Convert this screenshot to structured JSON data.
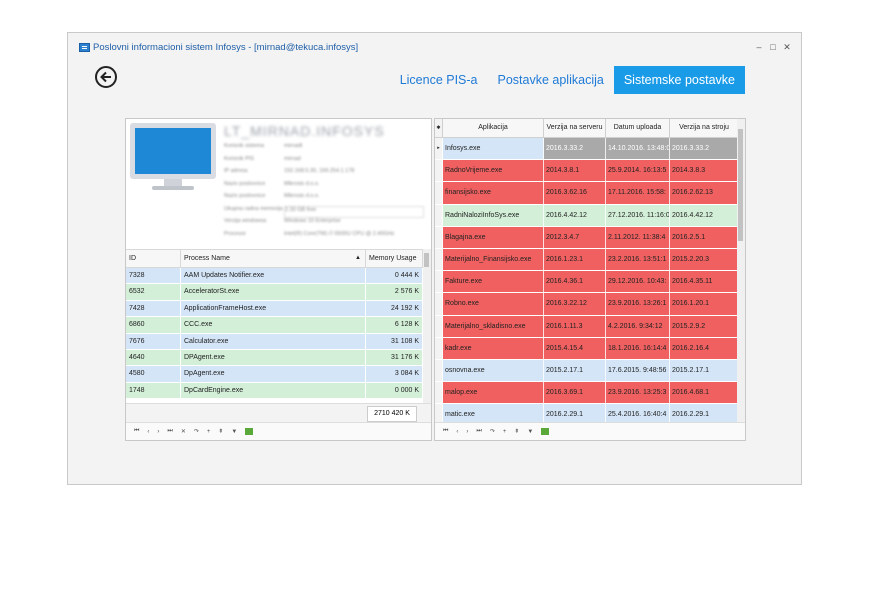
{
  "window": {
    "title": "Poslovni informacioni sistem Infosys - [mirnad@tekuca.infosys]",
    "controls": [
      "–",
      "□",
      "✕"
    ]
  },
  "tabs": [
    {
      "label": "Licence PIS-a",
      "active": false
    },
    {
      "label": "Postavke aplikacija",
      "active": false
    },
    {
      "label": "Sistemske postavke",
      "active": true
    }
  ],
  "computer": {
    "hostname": "LT_MIRNAD.INFOSYS",
    "info": [
      {
        "key": "Korisnik sistema",
        "value": "mirnadt"
      },
      {
        "key": "Korisnik PIS",
        "value": "mirnad"
      },
      {
        "key": "IP adresa",
        "value": "192.168.5.30, 169.254.1.178"
      },
      {
        "key": "Naziv poslovnice",
        "value": "Mikrosis d.o.o."
      },
      {
        "key": "Naziv poslovnice",
        "value": "Mikrosis d.o.o."
      },
      {
        "key": "Ukupna radna memorija",
        "value": "2.33 GB free"
      },
      {
        "key": "Verzija windowsa",
        "value": "Windows 10 Enterprise"
      },
      {
        "key": "Procesor",
        "value": "Intel(R) Core(TM) i7-5500U CPU @ 2.40GHz"
      }
    ]
  },
  "processes": {
    "columns": [
      "ID",
      "Process Name",
      "Memory Usage"
    ],
    "rows": [
      {
        "id": "7328",
        "name": "AAM Updates Notifier.exe",
        "mem": "0 444 K",
        "color": "#d4e5f7"
      },
      {
        "id": "6532",
        "name": "AcceleratorSt.exe",
        "mem": "2 576 K",
        "color": "#d3efd8"
      },
      {
        "id": "7428",
        "name": "ApplicationFrameHost.exe",
        "mem": "24 192 K",
        "color": "#d4e5f7"
      },
      {
        "id": "6860",
        "name": "CCC.exe",
        "mem": "6 128 K",
        "color": "#d3efd8"
      },
      {
        "id": "7676",
        "name": "Calculator.exe",
        "mem": "31 108 K",
        "color": "#d4e5f7"
      },
      {
        "id": "4640",
        "name": "DPAgent.exe",
        "mem": "31 176 K",
        "color": "#d3efd8"
      },
      {
        "id": "4580",
        "name": "DpAgent.exe",
        "mem": "3 084 K",
        "color": "#d4e5f7"
      },
      {
        "id": "1748",
        "name": "DpCardEngine.exe",
        "mem": "0 000 K",
        "color": "#d3efd8"
      }
    ],
    "total": "2710 420 K",
    "nav": [
      "⏮",
      "‹",
      "›",
      "⏭",
      "✕",
      "↷",
      "+",
      "⇞",
      "▼"
    ]
  },
  "applications": {
    "columns": [
      "Aplikacija",
      "Verzija na serveru",
      "Datum uploada",
      "Verzija na stroju"
    ],
    "rows": [
      {
        "app": "Infosys.exe",
        "vs": "2016.3.33.2",
        "du": "14.10.2016. 13:48:0",
        "vst": "2016.3.33.2",
        "color": "#d4e5f7",
        "selected": true
      },
      {
        "app": "RadnoVrijeme.exe",
        "vs": "2014.3.8.1",
        "du": "25.9.2014. 16:13:5",
        "vst": "2014.3.8.3",
        "color": "#f06060"
      },
      {
        "app": "finansijsko.exe",
        "vs": "2016.3.62.16",
        "du": "17.11.2016. 15:58:",
        "vst": "2016.2.62.13",
        "color": "#f06060"
      },
      {
        "app": "RadniNaloziInfoSys.exe",
        "vs": "2016.4.42.12",
        "du": "27.12.2016. 11:16:0",
        "vst": "2016.4.42.12",
        "color": "#d3efd8"
      },
      {
        "app": "Blagajna.exe",
        "vs": "2012.3.4.7",
        "du": "2.11.2012. 11:38:4",
        "vst": "2016.2.5.1",
        "color": "#f06060"
      },
      {
        "app": "Materijalno_Finansijsko.exe",
        "vs": "2016.1.23.1",
        "du": "23.2.2016. 13:51:1",
        "vst": "2015.2.20.3",
        "color": "#f06060"
      },
      {
        "app": "Fakture.exe",
        "vs": "2016.4.36.1",
        "du": "29.12.2016. 10:43:",
        "vst": "2016.4.35.11",
        "color": "#f06060"
      },
      {
        "app": "Robno.exe",
        "vs": "2016.3.22.12",
        "du": "23.9.2016. 13:26:1",
        "vst": "2016.1.20.1",
        "color": "#f06060"
      },
      {
        "app": "Materijalno_skladisno.exe",
        "vs": "2016.1.11.3",
        "du": "4.2.2016. 9:34:12",
        "vst": "2015.2.9.2",
        "color": "#f06060"
      },
      {
        "app": "kadr.exe",
        "vs": "2015.4.15.4",
        "du": "18.1.2016. 16:14:4",
        "vst": "2016.2.16.4",
        "color": "#f06060"
      },
      {
        "app": "osnovna.exe",
        "vs": "2015.2.17.1",
        "du": "17.6.2015. 9:48:56",
        "vst": "2015.2.17.1",
        "color": "#d4e5f7"
      },
      {
        "app": "malop.exe",
        "vs": "2016.3.69.1",
        "du": "23.9.2016. 13:25:3",
        "vst": "2016.4.68.1",
        "color": "#f06060"
      },
      {
        "app": "matic.exe",
        "vs": "2016.2.29.1",
        "du": "25.4.2016. 16:40:4",
        "vst": "2016.2.29.1",
        "color": "#d4e5f7"
      }
    ],
    "nav": [
      "⏮",
      "‹",
      "›",
      "⏭",
      "↷",
      "+",
      "⇞",
      "▼"
    ]
  },
  "icons": {
    "back": "back-arrow-icon",
    "app": "app-logo-icon",
    "computer": "monitor-icon"
  },
  "colors": {
    "accent": "#1a9be8",
    "outdated": "#f06060",
    "ok_green": "#d3efd8",
    "ok_blue": "#d4e5f7"
  }
}
